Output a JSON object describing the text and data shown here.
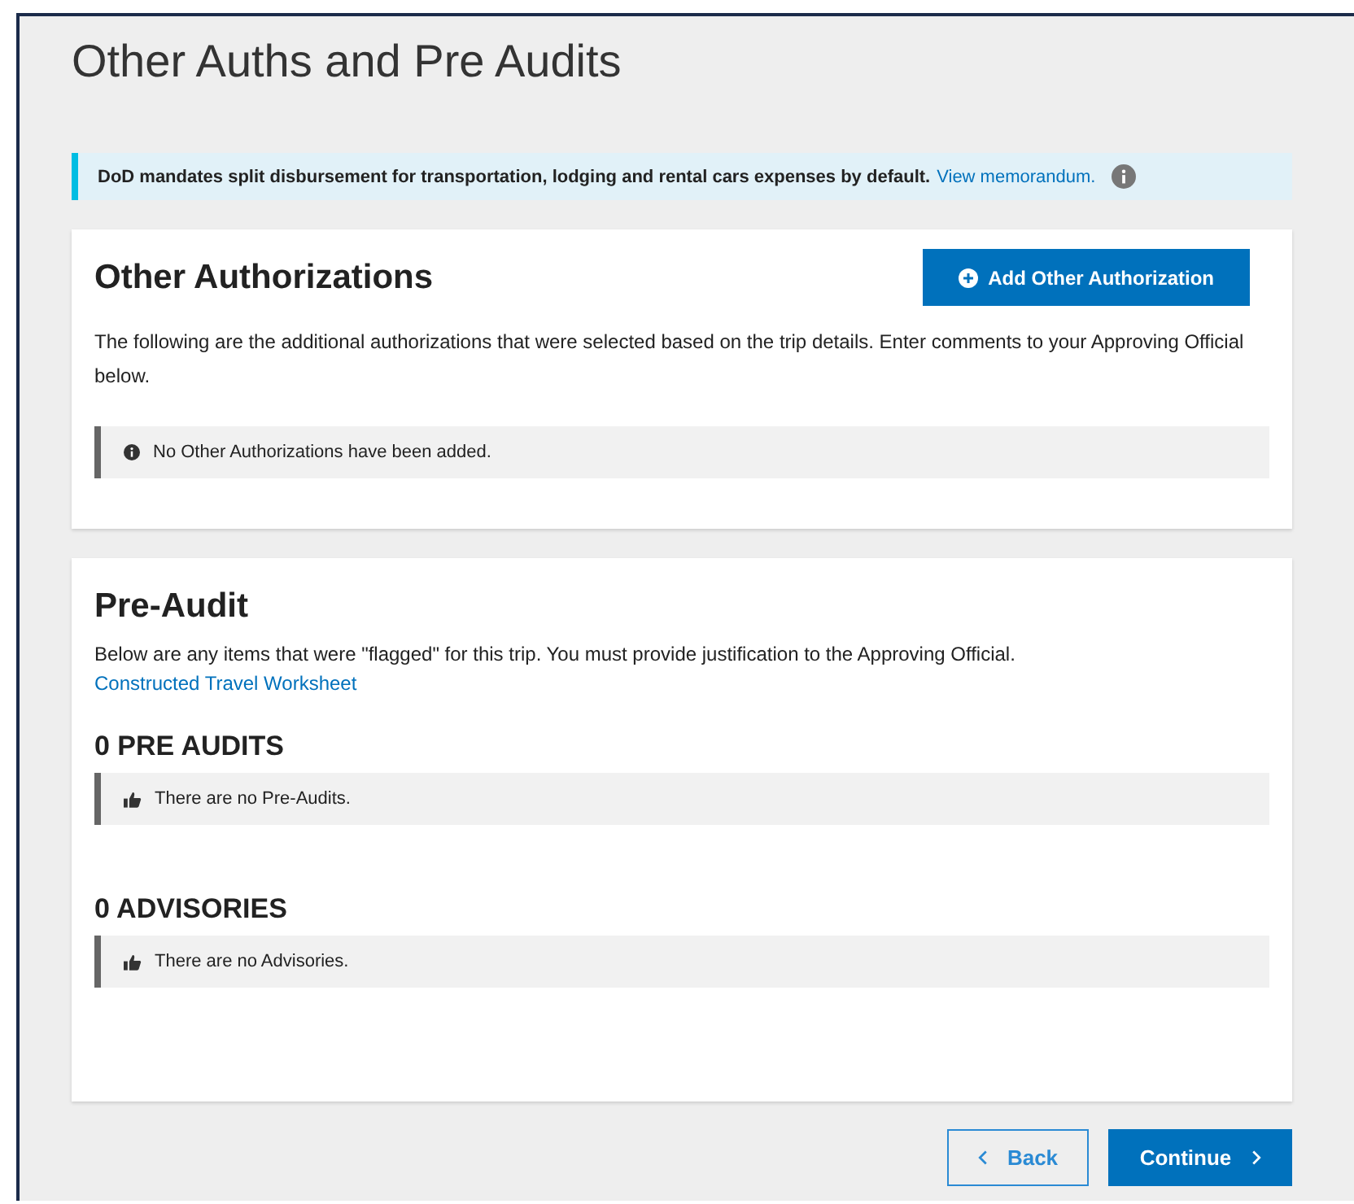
{
  "page_title": "Other Auths and Pre Audits",
  "banner": {
    "text": "DoD mandates split disbursement for transportation, lodging and rental cars expenses by default.",
    "link": "View memorandum."
  },
  "other_authorizations": {
    "title": "Other Authorizations",
    "add_button": "Add Other Authorization",
    "description": "The following are the additional authorizations that were selected based on the trip details. Enter comments to your Approving Official below.",
    "notice": {
      "kind": "info",
      "text": "No Other Authorizations have been added."
    }
  },
  "pre_audit": {
    "title": "Pre-Audit",
    "description": "Below are any items that were \"flagged\" for this trip. You must provide justification to the Approving Official.",
    "link": "Constructed Travel Worksheet",
    "groups": [
      {
        "heading": "0 PRE AUDITS",
        "notice": {
          "kind": "thumbs-up",
          "text": "There are no Pre-Audits."
        }
      },
      {
        "heading": "0 ADVISORIES",
        "notice": {
          "kind": "thumbs-up",
          "text": "There are no Advisories."
        }
      }
    ]
  },
  "buttons": {
    "back": "Back",
    "continue": "Continue"
  }
}
